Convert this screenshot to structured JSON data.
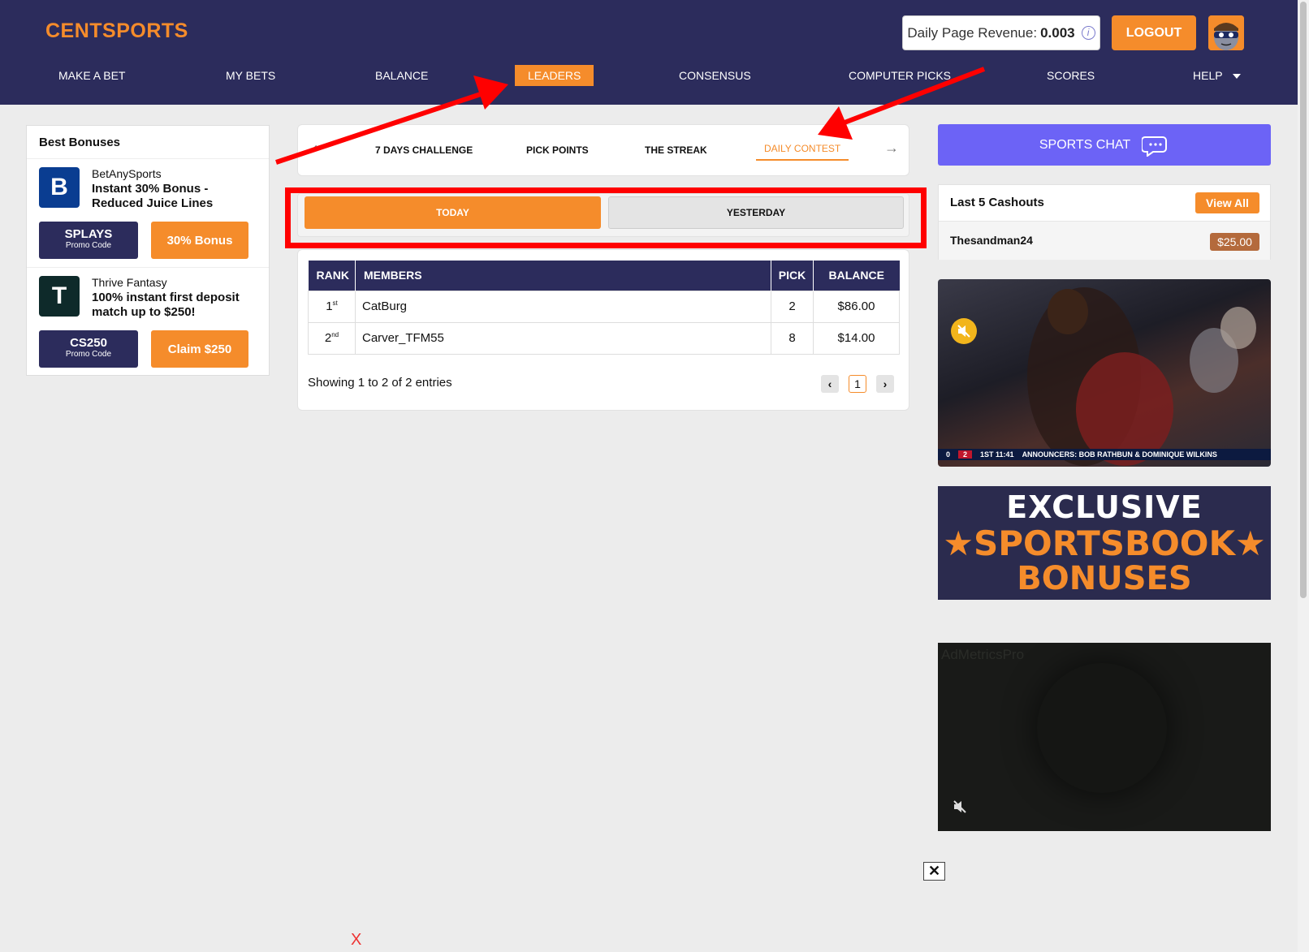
{
  "header": {
    "logo": "CENTSPORTS",
    "revenue_label": "Daily Page Revenue:",
    "revenue_value": "0.003",
    "info_glyph": "i",
    "logout": "LOGOUT",
    "avatar_icon": "masked-avatar-icon",
    "nav": [
      "MAKE A BET",
      "MY BETS",
      "BALANCE",
      "LEADERS",
      "CONSENSUS",
      "COMPUTER PICKS",
      "SCORES",
      "HELP"
    ],
    "nav_active": "LEADERS"
  },
  "bonuses": {
    "title": "Best Bonuses",
    "items": [
      {
        "logo_letter": "B",
        "logo_color": "#0a3d91",
        "name": "BetAnySports",
        "desc": "Instant 30% Bonus - Reduced Juice Lines",
        "promo_code": "SPLAYS",
        "promo_sub": "Promo Code",
        "cta": "30% Bonus"
      },
      {
        "logo_letter": "T",
        "logo_color": "#0e2a2a",
        "name": "Thrive Fantasy",
        "desc": "100% instant first deposit match up to $250!",
        "promo_code": "CS250",
        "promo_sub": "Promo Code",
        "cta": "Claim $250"
      }
    ]
  },
  "tabs": {
    "items": [
      "7 DAYS CHALLENGE",
      "PICK POINTS",
      "THE STREAK",
      "DAILY CONTEST"
    ],
    "active": "DAILY CONTEST",
    "prev_glyph": "‹",
    "next_glyph": "→"
  },
  "day_toggle": {
    "today": "TODAY",
    "yesterday": "YESTERDAY",
    "active": "TODAY"
  },
  "leaderboard": {
    "columns": [
      "RANK",
      "MEMBERS",
      "PICK",
      "BALANCE"
    ],
    "rows": [
      {
        "rank": "1",
        "suffix": "st",
        "member": "CatBurg",
        "pick": "2",
        "balance": "$86.00"
      },
      {
        "rank": "2",
        "suffix": "nd",
        "member": "Carver_TFM55",
        "pick": "8",
        "balance": "$14.00"
      }
    ],
    "showing": "Showing 1 to 2 of 2 entries",
    "page": "1",
    "prev": "‹",
    "next": "›"
  },
  "sidebar_right": {
    "chat_label": "SPORTS CHAT",
    "cashouts_title": "Last 5 Cashouts",
    "view_all": "View All",
    "cashouts": [
      {
        "user": "Thesandman24",
        "amount": "$25.00"
      }
    ]
  },
  "video": {
    "mute_icon": "muted-speaker-icon",
    "score_home": "0",
    "score_away": "2",
    "clock": "1ST 11:41",
    "announcers": "ANNOUNCERS: BOB RATHBUN & DOMINIQUE WILKINS"
  },
  "ad": {
    "line1": "EXCLUSIVE",
    "line2": "★SPORTSBOOK★",
    "line3": "BONUSES"
  },
  "video2": {
    "brand": "AdMetricsPro",
    "mute_icon": "muted-speaker-icon"
  },
  "close_glyph": "✕",
  "tiny_glyph": "X",
  "colors": {
    "brand_navy": "#2c2c5c",
    "accent_orange": "#f58c2b",
    "chat_purple": "#6c63f6",
    "annotation_red": "#ff0000"
  }
}
